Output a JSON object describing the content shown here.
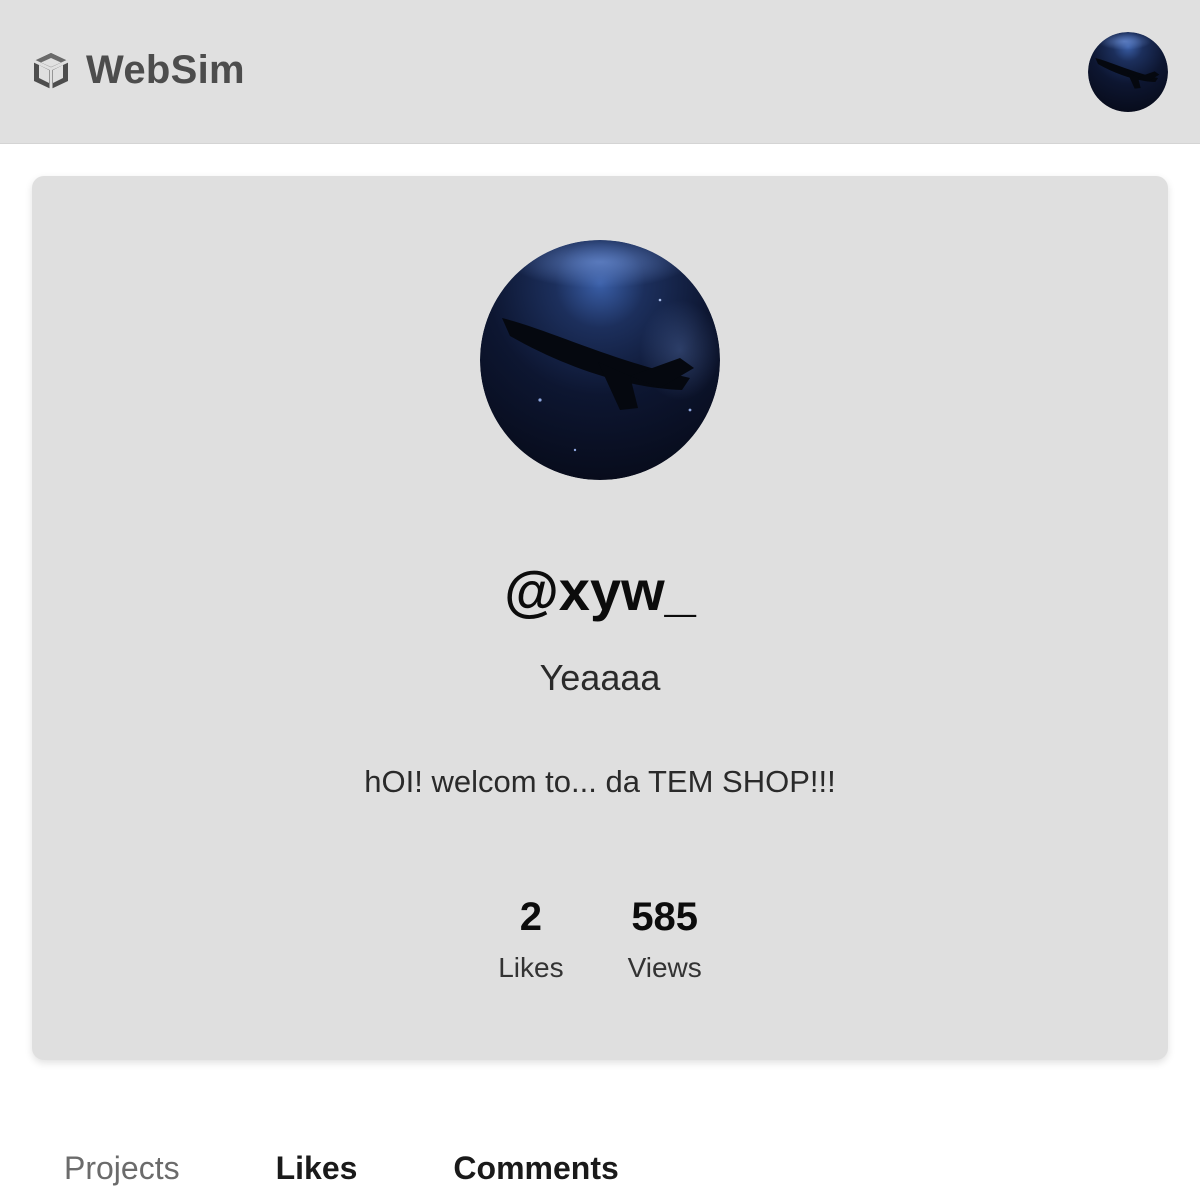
{
  "header": {
    "brand_name": "WebSim",
    "brand_icon": "cube-icon",
    "user_avatar_icon": "space-shuttle-avatar"
  },
  "profile": {
    "avatar_icon": "space-shuttle-avatar",
    "handle": "@xyw_",
    "display_name": "Yeaaaa",
    "bio": "hOI! welcom to... da TEM SHOP!!!",
    "stats": [
      {
        "value": "2",
        "label": "Likes"
      },
      {
        "value": "585",
        "label": "Views"
      }
    ]
  },
  "tabs": [
    {
      "label": "Projects",
      "active": false
    },
    {
      "label": "Likes",
      "active": true
    },
    {
      "label": "Comments",
      "active": true
    }
  ],
  "colors": {
    "header_bg": "#e0e0e0",
    "card_bg": "#dfdfdf",
    "brand_text": "#4d4d4d",
    "avatar_dark": "#0a1226",
    "avatar_blue": "#2c4a86"
  }
}
